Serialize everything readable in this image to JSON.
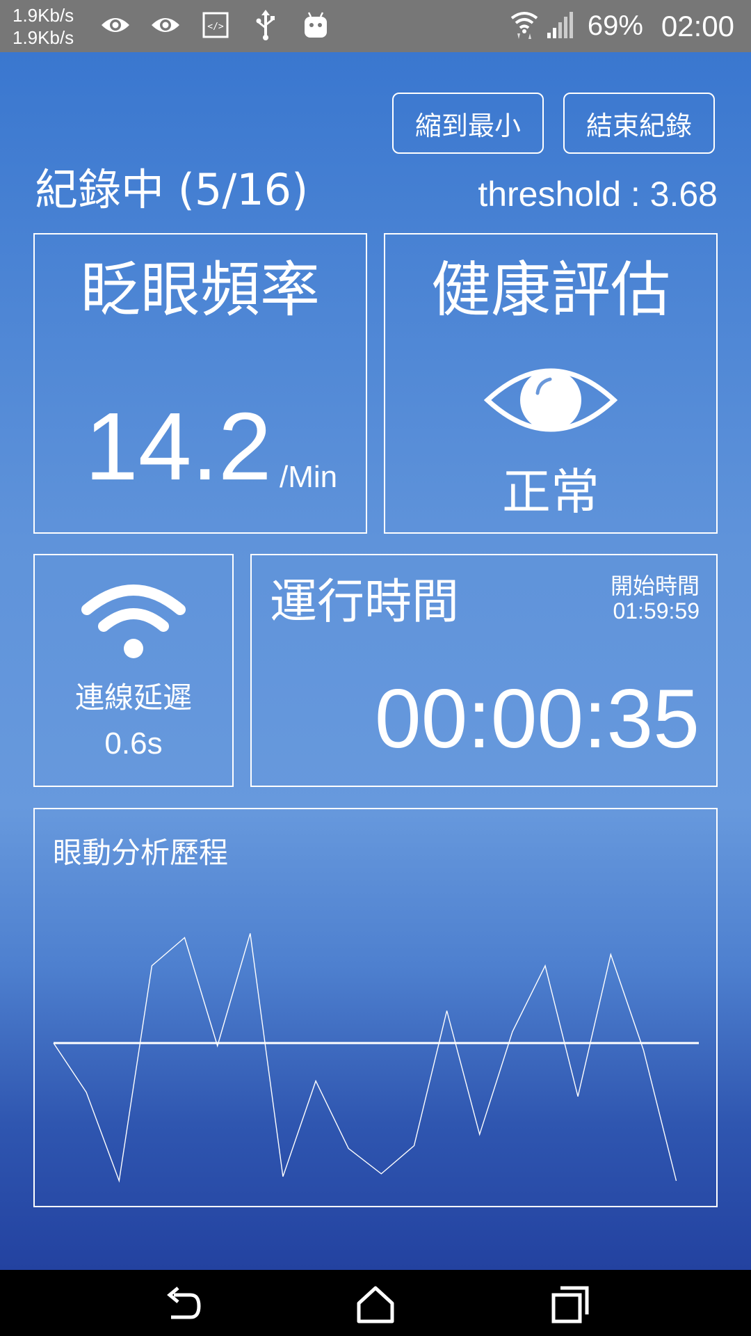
{
  "status_bar": {
    "net_up": "1.9Kb/s",
    "net_down": "1.9Kb/s",
    "battery": "69%",
    "time": "02:00",
    "icons": [
      "eye-icon",
      "eye-icon",
      "code-icon",
      "usb-icon",
      "android-icon",
      "wifi-icon",
      "signal-icon"
    ]
  },
  "toolbar": {
    "minimize_label": "縮到最小",
    "stop_label": "結束紀錄"
  },
  "header": {
    "status_title": "紀錄中 (5/16)",
    "threshold": "threshold : 3.68"
  },
  "blink_panel": {
    "title": "眨眼頻率",
    "value": "14.2",
    "unit": "/Min"
  },
  "health_panel": {
    "title": "健康評估",
    "status": "正常",
    "icon": "eye-icon"
  },
  "network_panel": {
    "label": "連線延遲",
    "value": "0.6s",
    "icon": "wifi-icon"
  },
  "runtime_panel": {
    "title": "運行時間",
    "start_label": "開始時間",
    "start_time": "01:59:59",
    "elapsed": "00:00:35"
  },
  "chart_panel": {
    "title": "眼動分析歷程"
  },
  "chart_data": {
    "type": "line",
    "title": "眼動分析歷程",
    "threshold_line": 0,
    "ylim": [
      -1,
      1
    ],
    "series": [
      {
        "values": [
          0.0,
          -0.35,
          -0.98,
          0.55,
          0.75,
          -0.02,
          0.78,
          -0.95,
          -0.27,
          -0.75,
          -0.93,
          -0.73,
          0.23,
          -0.65,
          0.08,
          0.55,
          -0.38,
          0.63,
          -0.05,
          -0.98
        ]
      }
    ]
  },
  "colors": {
    "background_top": "#3a77cf",
    "background_mid": "#6799dd",
    "background_bottom": "#2342a0",
    "status_bar": "#777777",
    "foreground": "#ffffff"
  },
  "nav_bar": {
    "icons": [
      "back-icon",
      "home-icon",
      "recents-icon"
    ]
  }
}
